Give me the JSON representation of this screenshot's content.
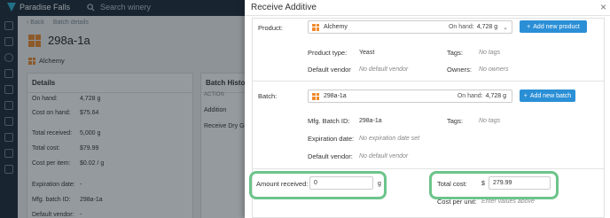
{
  "app": {
    "brand": "Paradise Falls",
    "search_placeholder": "Search winery",
    "back_label": "Back",
    "breadcrumb": "Batch details",
    "batch_title": "298a-1a",
    "batch_product": "Alchemy"
  },
  "details_panel": {
    "title": "Details",
    "rows": [
      {
        "label": "On hand:",
        "value": "4,728 g"
      },
      {
        "label": "Cost on hand:",
        "value": "$75.64"
      },
      {
        "label": "Total received:",
        "value": "5,000 g"
      },
      {
        "label": "Total cost:",
        "value": "$79.99"
      },
      {
        "label": "Cost per item:",
        "value": "$0.02 / g"
      },
      {
        "label": "Expiration date:",
        "value": "-"
      },
      {
        "label": "Mfg. batch ID:",
        "value": "298a-1a"
      },
      {
        "label": "Default vendor:",
        "value": "-"
      }
    ]
  },
  "history_panel": {
    "title": "Batch Histor",
    "column": "ACTION",
    "items": [
      "Addition",
      "Receive Dry Go"
    ]
  },
  "modal": {
    "title": "Receive Additive",
    "close": "×",
    "product": {
      "label": "Product:",
      "selected": "Alchemy",
      "on_hand_label": "On hand:",
      "on_hand_value": "4,728 g",
      "add_button": "Add new product",
      "product_type_label": "Product type:",
      "product_type_value": "Yeast",
      "tags_label": "Tags:",
      "tags_value": "No tags",
      "vendor_label": "Default vendor",
      "vendor_value": "No default vendor",
      "owners_label": "Owners:",
      "owners_value": "No owners"
    },
    "batch": {
      "label": "Batch:",
      "selected": "298a-1a",
      "on_hand_label": "On hand:",
      "on_hand_value": "4,728 g",
      "add_button": "Add new batch",
      "mfg_label": "Mfg. Batch ID:",
      "mfg_value": "298a-1a",
      "tags_label": "Tags:",
      "tags_value": "No tags",
      "exp_label": "Expiration date:",
      "exp_value": "No expiration date set",
      "vendor_label": "Default vendor:",
      "vendor_value": "No default vendor"
    },
    "amount": {
      "label": "Amount received:",
      "value": "0",
      "unit": "g"
    },
    "cost": {
      "label": "Total cost:",
      "currency": "$",
      "value": "279.99",
      "per_unit_label": "Cost per unit:",
      "per_unit_value": "Enter values above"
    }
  },
  "colors": {
    "accent": "#2b8fd6",
    "highlight": "#6cc48a",
    "product_icon": "#f08a2c",
    "nav_bg": "#1d2b3a"
  }
}
